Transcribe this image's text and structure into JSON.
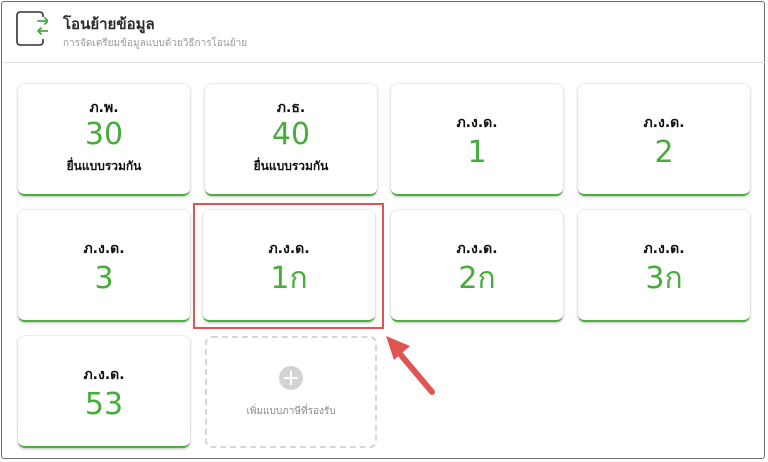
{
  "header": {
    "title": "โอนย้ายข้อมูล",
    "subtitle": "การจัดเตรียมข้อมูลแบบด้วยวิธีการโอนย้าย",
    "icon": "transfer-icon"
  },
  "cards": [
    {
      "category": "ภ.พ.",
      "number": "30",
      "sub": "ยื่นแบบรวมกัน"
    },
    {
      "category": "ภ.ธ.",
      "number": "40",
      "sub": "ยื่นแบบรวมกัน"
    },
    {
      "category": "ภ.ง.ด.",
      "number": "1"
    },
    {
      "category": "ภ.ง.ด.",
      "number": "2"
    },
    {
      "category": "ภ.ง.ด.",
      "number": "3"
    },
    {
      "category": "ภ.ง.ด.",
      "number": "1ก"
    },
    {
      "category": "ภ.ง.ด.",
      "number": "2ก"
    },
    {
      "category": "ภ.ง.ด.",
      "number": "3ก"
    },
    {
      "category": "ภ.ง.ด.",
      "number": "53"
    }
  ],
  "add_card": {
    "label": "เพิ่มแบบภาษีที่รองรับ",
    "icon": "plus-icon"
  },
  "colors": {
    "accent": "#47ad3a",
    "highlight": "#e05454"
  }
}
